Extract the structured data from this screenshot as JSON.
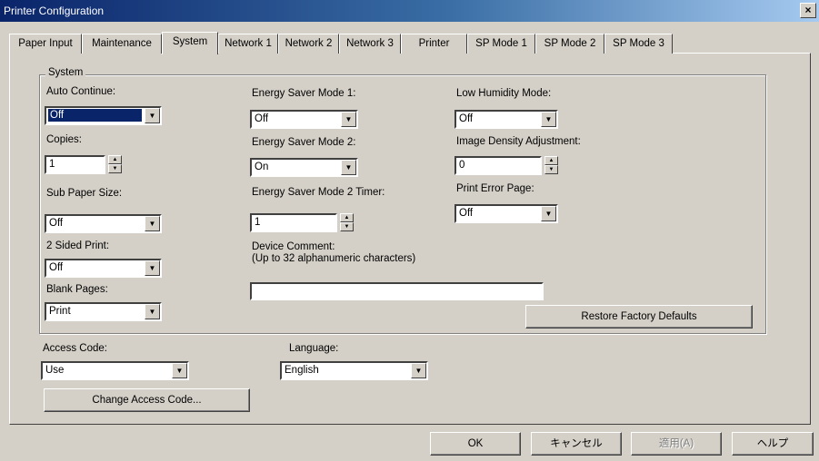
{
  "window": {
    "title": "Printer Configuration",
    "close_label": "×"
  },
  "tabs": [
    {
      "label": "Paper Input"
    },
    {
      "label": "Maintenance"
    },
    {
      "label": "System"
    },
    {
      "label": "Network 1"
    },
    {
      "label": "Network 2"
    },
    {
      "label": "Network 3"
    },
    {
      "label": "Printer"
    },
    {
      "label": "SP Mode 1"
    },
    {
      "label": "SP Mode 2"
    },
    {
      "label": "SP Mode 3"
    }
  ],
  "active_tab": "System",
  "system": {
    "group_title": "System",
    "auto_continue": {
      "label": "Auto Continue:",
      "value": "Off"
    },
    "copies": {
      "label": "Copies:",
      "value": "1"
    },
    "sub_paper_size": {
      "label": "Sub Paper Size:",
      "value": "Off"
    },
    "two_sided_print": {
      "label": "2 Sided Print:",
      "value": "Off"
    },
    "blank_pages": {
      "label": "Blank Pages:",
      "value": "Print"
    },
    "energy_saver_1": {
      "label": "Energy Saver Mode 1:",
      "value": "Off"
    },
    "energy_saver_2": {
      "label": "Energy Saver Mode 2:",
      "value": "On"
    },
    "energy_saver_2_timer": {
      "label": "Energy Saver Mode 2 Timer:",
      "value": "1"
    },
    "device_comment": {
      "label": "Device Comment:",
      "hint": "(Up to 32 alphanumeric characters)",
      "value": ""
    },
    "low_humidity": {
      "label": "Low Humidity Mode:",
      "value": "Off"
    },
    "image_density": {
      "label": "Image Density Adjustment:",
      "value": "0"
    },
    "print_error_page": {
      "label": "Print Error Page:",
      "value": "Off"
    },
    "restore_defaults_label": "Restore Factory Defaults"
  },
  "access_code": {
    "label": "Access Code:",
    "value": "Use",
    "change_button": "Change Access Code..."
  },
  "language": {
    "label": "Language:",
    "value": "English"
  },
  "footer": {
    "ok": "OK",
    "cancel": "キャンセル",
    "apply": "適用(A)",
    "help": "ヘルプ"
  },
  "colors": {
    "title_bar": "#0a246a",
    "face": "#d4d0c8",
    "selection": "#0a246a"
  }
}
